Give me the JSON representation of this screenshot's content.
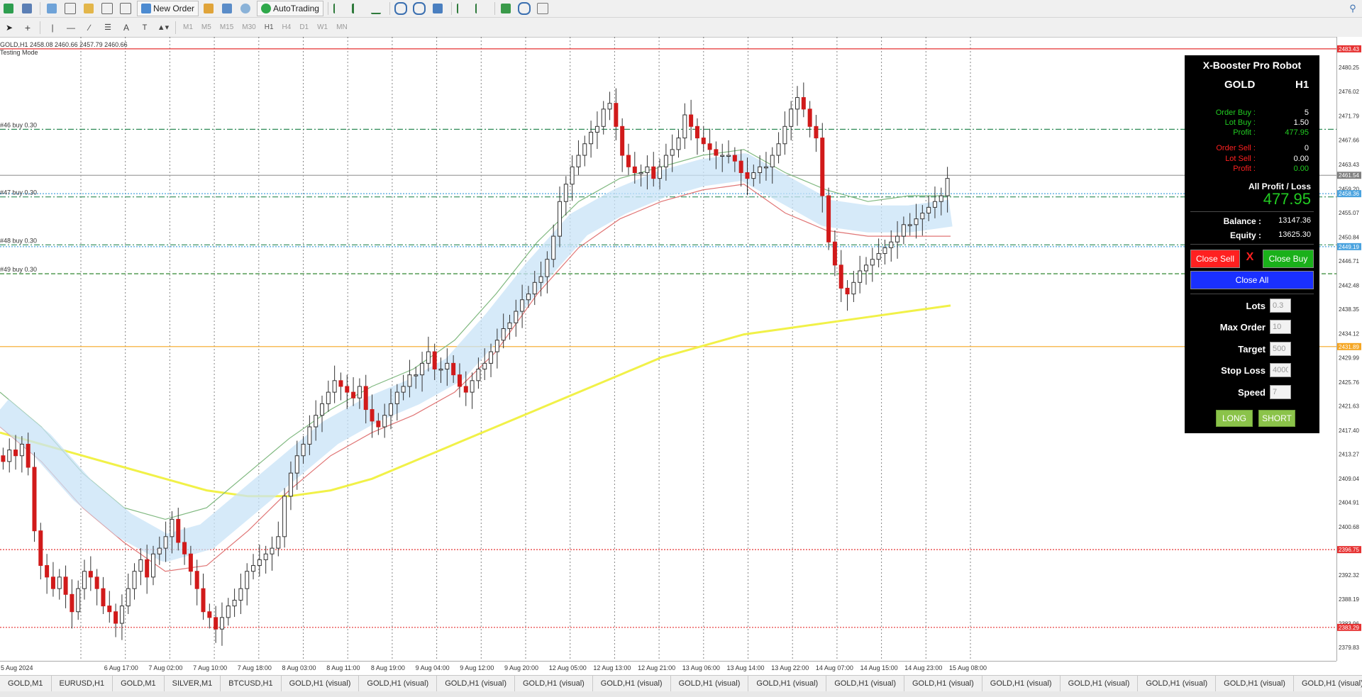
{
  "toolbar": {
    "new_order_label": "New Order",
    "autotrading_label": "AutoTrading",
    "timeframes": [
      "M1",
      "M5",
      "M15",
      "M30",
      "H1",
      "H4",
      "D1",
      "W1",
      "MN"
    ],
    "active_timeframe": "H1"
  },
  "chart": {
    "info_line": "GOLD,H1  2458.08 2460.66 2457.79 2460.66",
    "mode_label": "Testing Mode",
    "price_axis": [
      "2480.25",
      "2476.02",
      "2471.79",
      "2467.66",
      "2463.43",
      "2459.20",
      "2455.07",
      "2450.84",
      "2446.71",
      "2442.48",
      "2438.35",
      "2434.12",
      "2429.99",
      "2425.76",
      "2421.63",
      "2417.40",
      "2413.27",
      "2409.04",
      "2404.91",
      "2400.68",
      "2396.55",
      "2392.32",
      "2388.19",
      "2383.96",
      "2379.83"
    ],
    "price_labels_highlight": [
      {
        "text": "2483.43",
        "color": "#e63232"
      },
      {
        "text": "2461.54",
        "color": "#808080"
      },
      {
        "text": "2458.36",
        "color": "#4aa3df"
      },
      {
        "text": "2449.19",
        "color": "#4aa3df"
      },
      {
        "text": "2431.89",
        "color": "#f5a623"
      },
      {
        "text": "2396.75",
        "color": "#e63232"
      },
      {
        "text": "2383.29",
        "color": "#e63232"
      }
    ],
    "time_axis": [
      "5 Aug 2024",
      "6 Aug 17:00",
      "7 Aug 02:00",
      "7 Aug 10:00",
      "7 Aug 18:00",
      "8 Aug 03:00",
      "8 Aug 11:00",
      "8 Aug 19:00",
      "9 Aug 04:00",
      "9 Aug 12:00",
      "9 Aug 20:00",
      "12 Aug 05:00",
      "12 Aug 13:00",
      "12 Aug 21:00",
      "13 Aug 06:00",
      "13 Aug 14:00",
      "13 Aug 22:00",
      "14 Aug 07:00",
      "14 Aug 15:00",
      "14 Aug 23:00",
      "15 Aug 08:00"
    ],
    "order_labels": [
      "#46 buy 0.30",
      "#47 buy 0.30",
      "#48 buy 0.30",
      "#49 buy 0.30"
    ]
  },
  "panel": {
    "title": "X-Booster Pro Robot",
    "symbol": "GOLD",
    "timeframe": "H1",
    "order_buy_label": "Order Buy :",
    "order_buy_value": "5",
    "lot_buy_label": "Lot Buy :",
    "lot_buy_value": "1.50",
    "profit_buy_label": "Profit :",
    "profit_buy_value": "477.95",
    "order_sell_label": "Order Sell :",
    "order_sell_value": "0",
    "lot_sell_label": "Lot Sell :",
    "lot_sell_value": "0.00",
    "profit_sell_label": "Profit :",
    "profit_sell_value": "0.00",
    "all_pl_label": "All Profit / Loss",
    "all_pl_value": "477.95",
    "balance_label": "Balance :",
    "balance_value": "13147.36",
    "equity_label": "Equity :",
    "equity_value": "13625.30",
    "close_sell_label": "Close Sell",
    "close_x_label": "X",
    "close_buy_label": "Close Buy",
    "close_all_label": "Close All",
    "lots_label": "Lots",
    "lots_value": "0.3",
    "max_order_label": "Max Order",
    "max_order_value": "10",
    "target_label": "Target",
    "target_value": "500",
    "stop_loss_label": "Stop Loss",
    "stop_loss_value": "4000",
    "speed_label": "Speed",
    "speed_value": "7",
    "long_label": "LONG",
    "short_label": "SHORT",
    "colors": {
      "green": "#22cc22",
      "red": "#ff2020",
      "blue": "#1a30ff",
      "lime": "#8bc34a"
    }
  },
  "tabs": [
    "GOLD,M1",
    "EURUSD,H1",
    "GOLD,M1",
    "SILVER,M1",
    "BTCUSD,H1",
    "GOLD,H1 (visual)",
    "GOLD,H1 (visual)",
    "GOLD,H1 (visual)",
    "GOLD,H1 (visual)",
    "GOLD,H1 (visual)",
    "GOLD,H1 (visual)",
    "GOLD,H1 (visual)",
    "GOLD,H1 (visual)",
    "GOLD,H1 (visual)",
    "GOLD,H1 (visual)",
    "GOLD,H1 (visual)",
    "GOLD,H1 (visual)",
    "GOLD,H1 (visual)",
    "GOLD,H1 (visual)",
    "GOLD,H1 (visual)",
    "GOLI"
  ],
  "chart_data": {
    "type": "candlestick",
    "ylim": [
      2377.5,
      2485.5
    ],
    "y_ticks": [
      2480.25,
      2476.02,
      2471.79,
      2467.66,
      2463.43,
      2459.2,
      2455.07,
      2450.84,
      2446.71,
      2442.48,
      2438.35,
      2434.12,
      2429.99,
      2425.76,
      2421.63,
      2417.4,
      2413.27,
      2409.04,
      2404.91,
      2400.68,
      2396.55,
      2392.32,
      2388.19,
      2383.96,
      2379.83
    ],
    "x_labels": [
      "5 Aug 2024",
      "6 Aug 17:00",
      "7 Aug 02:00",
      "7 Aug 10:00",
      "7 Aug 18:00",
      "8 Aug 03:00",
      "8 Aug 11:00",
      "8 Aug 19:00",
      "9 Aug 04:00",
      "9 Aug 12:00",
      "9 Aug 20:00",
      "12 Aug 05:00",
      "12 Aug 13:00",
      "12 Aug 21:00",
      "13 Aug 06:00",
      "13 Aug 14:00",
      "13 Aug 22:00",
      "14 Aug 07:00",
      "14 Aug 15:00",
      "14 Aug 23:00",
      "15 Aug 08:00"
    ],
    "close": [
      2412,
      2414,
      2413,
      2415,
      2411,
      2400,
      2394,
      2392,
      2390,
      2392,
      2389,
      2386,
      2390,
      2393,
      2392,
      2390,
      2387,
      2386,
      2384,
      2387,
      2390,
      2393,
      2395,
      2392,
      2396,
      2397,
      2399,
      2402,
      2398,
      2396,
      2393,
      2390,
      2386,
      2385,
      2383,
      2385,
      2387,
      2388,
      2390,
      2393,
      2394,
      2395,
      2396,
      2397,
      2399,
      2406,
      2410,
      2413,
      2415,
      2418,
      2420,
      2422,
      2424,
      2426,
      2425,
      2424,
      2423,
      2425,
      2421,
      2419,
      2418,
      2420,
      2422,
      2424,
      2425,
      2427,
      2427,
      2429,
      2431,
      2428,
      2428,
      2429,
      2427,
      2425,
      2424,
      2426,
      2428,
      2429,
      2431,
      2433,
      2435,
      2436,
      2438,
      2440,
      2441,
      2443,
      2444,
      2447,
      2451,
      2457,
      2460,
      2463,
      2465,
      2467,
      2469,
      2470,
      2473,
      2474,
      2470,
      2465,
      2463,
      2462,
      2462,
      2463,
      2461,
      2463,
      2465,
      2466,
      2468,
      2472,
      2470,
      2468,
      2467,
      2466,
      2465,
      2465,
      2465,
      2464,
      2462,
      2461,
      2462,
      2463,
      2463,
      2465,
      2467,
      2470,
      2473,
      2475,
      2473,
      2470,
      2468,
      2458,
      2450,
      2446,
      2442,
      2441,
      2443,
      2445,
      2446,
      2447,
      2448,
      2449,
      2450,
      2451,
      2453,
      2453,
      2454,
      2455,
      2456,
      2457,
      2458,
      2461
    ],
    "series": [
      {
        "name": "",
        "color": "#f1f148",
        "values": [
          2417,
          2415,
          2413,
          2411,
          2409,
          2407,
          2406,
          2406,
          2407,
          2409,
          2412,
          2415,
          2418,
          2421,
          2424,
          2427,
          2430,
          2432,
          2434,
          2435,
          2436,
          2437,
          2438,
          2439
        ]
      },
      {
        "name": "",
        "color": "#7fb87f",
        "values": [
          2424,
          2418,
          2410,
          2404,
          2402,
          2404,
          2410,
          2416,
          2421,
          2425,
          2428,
          2433,
          2441,
          2450,
          2457,
          2461,
          2463,
          2465,
          2466,
          2462,
          2459,
          2457,
          2458,
          2458
        ]
      },
      {
        "name": "",
        "color": "#e07575",
        "values": [
          2418,
          2412,
          2404,
          2398,
          2393,
          2394,
          2400,
          2407,
          2413,
          2417,
          2420,
          2424,
          2431,
          2441,
          2449,
          2454,
          2457,
          2459,
          2460,
          2455,
          2452,
          2451,
          2451,
          2451
        ]
      },
      {
        "name": "",
        "color": "#c8e3f7",
        "values": [
          2421,
          2415,
          2407,
          2401,
          2397,
          2399,
          2405,
          2411,
          2417,
          2421,
          2424,
          2428,
          2436,
          2445,
          2453,
          2457,
          2460,
          2462,
          2463,
          2459,
          2455,
          2454,
          2454,
          2455
        ]
      }
    ],
    "hlines": [
      {
        "y": 2483.43,
        "color": "#e63232",
        "style": "solid"
      },
      {
        "y": 2461.54,
        "color": "#a0a0a0",
        "style": "solid"
      },
      {
        "y": 2458.36,
        "color": "#4aa3df",
        "style": "dotted"
      },
      {
        "y": 2449.19,
        "color": "#4aa3df",
        "style": "dotted"
      },
      {
        "y": 2431.89,
        "color": "#f5a623",
        "style": "solid"
      },
      {
        "y": 2396.75,
        "color": "#e63232",
        "style": "dotted"
      },
      {
        "y": 2383.29,
        "color": "#e63232",
        "style": "dotted"
      },
      {
        "y": 2469.5,
        "color": "#2e8b57",
        "style": "dashdot"
      },
      {
        "y": 2457.8,
        "color": "#2e8b57",
        "style": "dashdot"
      },
      {
        "y": 2449.5,
        "color": "#2e8b57",
        "style": "dashdot"
      },
      {
        "y": 2444.5,
        "color": "#1a7a1a",
        "style": "dashed"
      }
    ]
  }
}
